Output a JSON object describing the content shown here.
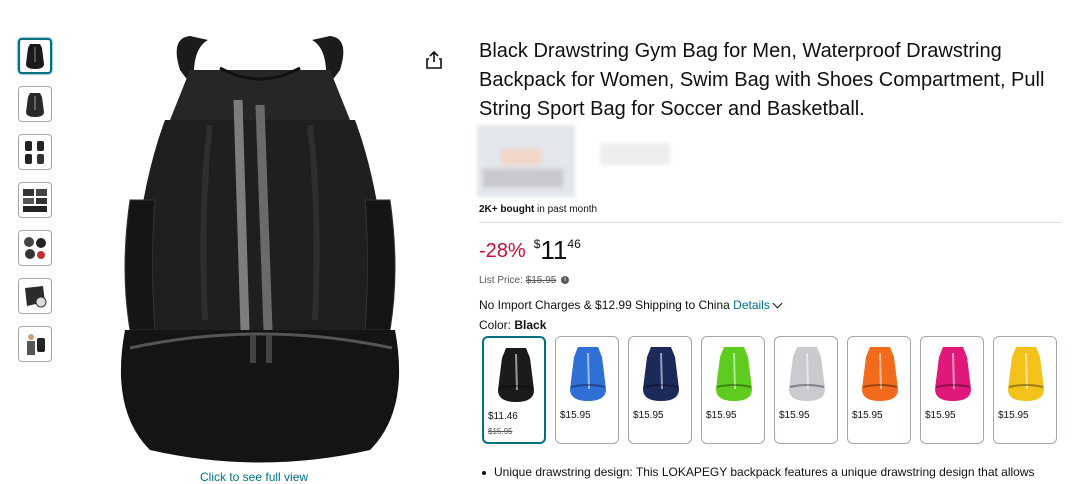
{
  "topbar": {
    "text": "· · · · · ·"
  },
  "gallery": {
    "thumbnail_count": 7,
    "full_view_text": "Click to see full view"
  },
  "product": {
    "title": "Black Drawstring Gym Bag for Men, Waterproof Drawstring Backpack for Women, Swim Bag with Shoes Compartment, Pull String Sport Bag for Soccer and Basketball.",
    "bought_bold": "2K+ bought",
    "bought_rest": " in past month",
    "discount": "-28%",
    "price_symbol": "$",
    "price_whole": "11",
    "price_fraction": "46",
    "list_price_label": "List Price: ",
    "list_price": "$15.95",
    "shipping_text": "No Import Charges & $12.99 Shipping to China ",
    "details_link": "Details",
    "color_label": "Color: ",
    "color_value": "Black",
    "bullet_1": "Unique drawstring design: This LOKAPEGY backpack features a unique drawstring design that allows"
  },
  "swatches": [
    {
      "color": "#1a1a1a",
      "price": "$11.46",
      "list_price": "$15.95",
      "selected": true
    },
    {
      "color": "#2f6fd6",
      "price": "$15.95"
    },
    {
      "color": "#1c2a5a",
      "price": "$15.95"
    },
    {
      "color": "#5ecb1f",
      "price": "$15.95"
    },
    {
      "color": "#c9cbcf",
      "price": "$15.95"
    },
    {
      "color": "#f26a1b",
      "price": "$15.95"
    },
    {
      "color": "#e0187a",
      "price": "$15.95"
    },
    {
      "color": "#f2c21a",
      "price": "$15.95"
    }
  ],
  "icons": {
    "share": "share-icon",
    "info": "info-icon",
    "chevron": "chevron-down-icon"
  }
}
